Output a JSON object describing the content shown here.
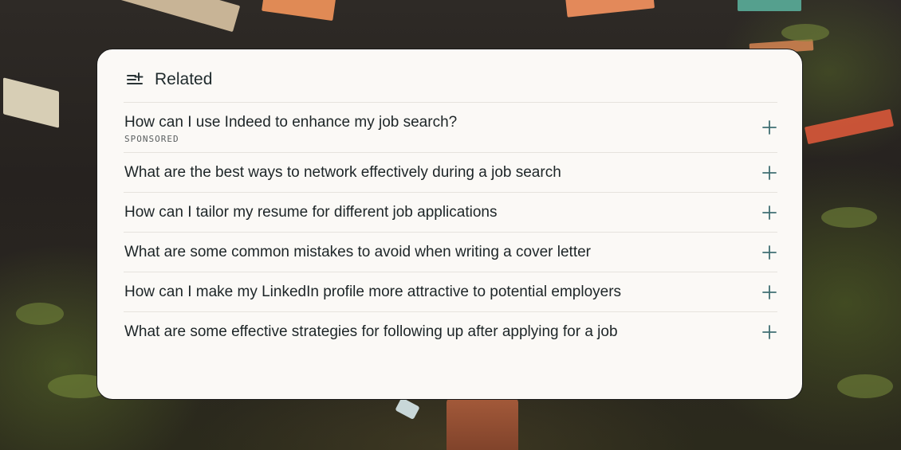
{
  "panel": {
    "title": "Related",
    "icon": "related-list-icon",
    "accent_color": "#3f6f73"
  },
  "items": [
    {
      "question": "How can I use Indeed to enhance my job search?",
      "badge": "SPONSORED"
    },
    {
      "question": "What are the best ways to network effectively during a job search"
    },
    {
      "question": "How can I tailor my resume for different job applications"
    },
    {
      "question": "What are some common mistakes to avoid when writing a cover letter"
    },
    {
      "question": "How can I make my LinkedIn profile more attractive to potential employers"
    },
    {
      "question": "What are some effective strategies for following up after applying for a job"
    }
  ]
}
